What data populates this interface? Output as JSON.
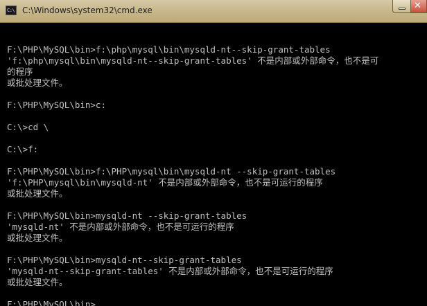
{
  "window": {
    "title": "C:\\Windows\\system32\\cmd.exe",
    "app_icon_text": "C:\\"
  },
  "console": {
    "lines": [
      "",
      "F:\\PHP\\MySQL\\bin>f:\\php\\mysql\\bin\\mysqld-nt--skip-grant-tables",
      "'f:\\php\\mysql\\bin\\mysqld-nt--skip-grant-tables' 不是内部或外部命令，也不是可",
      "的程序",
      "或批处理文件。",
      "",
      "F:\\PHP\\MySQL\\bin>c:",
      "",
      "C:\\>cd \\",
      "",
      "C:\\>f:",
      "",
      "F:\\PHP\\MySQL\\bin>f:\\PHP\\mysql\\bin\\mysqld-nt --skip-grant-tables",
      "'f:\\PHP\\mysql\\bin\\mysqld-nt' 不是内部或外部命令，也不是可运行的程序",
      "或批处理文件。",
      "",
      "F:\\PHP\\MySQL\\bin>mysqld-nt --skip-grant-tables",
      "'mysqld-nt' 不是内部或外部命令，也不是可运行的程序",
      "或批处理文件。",
      "",
      "F:\\PHP\\MySQL\\bin>mysqld-nt--skip-grant-tables",
      "'mysqld-nt--skip-grant-tables' 不是内部或外部命令，也不是可运行的程序",
      "或批处理文件。",
      "",
      "F:\\PHP\\MySQL\\bin>"
    ]
  },
  "colors": {
    "console_bg": "#000000",
    "console_text": "#c0c0c0",
    "titlebar": "#c9b98d",
    "close_button": "#c9503b"
  },
  "icons": {
    "app_icon": "cmd-icon",
    "minimize": "minimize-icon",
    "close": "close-icon"
  }
}
